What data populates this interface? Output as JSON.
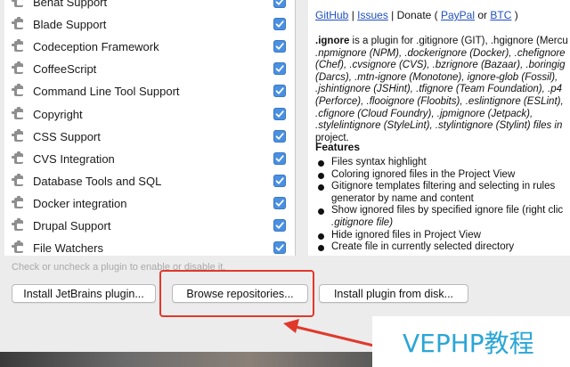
{
  "plugins": [
    {
      "name": "Behat Support",
      "checked": true
    },
    {
      "name": "Blade Support",
      "checked": true
    },
    {
      "name": "Codeception Framework",
      "checked": true
    },
    {
      "name": "CoffeeScript",
      "checked": true
    },
    {
      "name": "Command Line Tool Support",
      "checked": true
    },
    {
      "name": "Copyright",
      "checked": true
    },
    {
      "name": "CSS Support",
      "checked": true
    },
    {
      "name": "CVS Integration",
      "checked": true
    },
    {
      "name": "Database Tools and SQL",
      "checked": true
    },
    {
      "name": "Docker integration",
      "checked": true
    },
    {
      "name": "Drupal Support",
      "checked": true
    },
    {
      "name": "File Watchers",
      "checked": true
    }
  ],
  "detail": {
    "links": {
      "github": "GitHub",
      "sep1": " | ",
      "issues": "Issues",
      "sep2": " | Donate ( ",
      "paypal": "PayPal",
      "or": " or ",
      "btc": "BTC",
      "close": " )"
    },
    "desc_lead": ".ignore",
    "desc_lines": [
      " is a plugin for .gitignore (GIT), .hgignore (Mercu",
      ".npmignore (NPM), .dockerignore (Docker), .chefignore",
      "(Chef), .cvsignore (CVS), .bzrignore (Bazaar), .boringig",
      "(Darcs), .mtn-ignore (Monotone), ignore-glob (Fossil),",
      ".jshintignore (JSHint), .tfignore (Team Foundation), .p4",
      "(Perforce), .flooignore (Floobits), .eslintignore (ESLint),",
      ".cfignore (Cloud Foundry), .jpmignore (Jetpack),",
      ".stylelintignore (StyleLint), .stylintignore (Stylint) files in",
      "project."
    ],
    "features_title": "Features",
    "features": [
      "Files syntax highlight",
      "Coloring ignored files in the Project View",
      "Gitignore templates filtering and selecting in rules",
      "generator by name and content",
      "Show ignored files by specified ignore file (right clic",
      ".gitignore file)",
      "Hide ignored files in Project View",
      "Create file in currently selected directory"
    ]
  },
  "hint": "Check or uncheck a plugin to enable or disable it.",
  "buttons": {
    "install_jetbrains": "Install JetBrains plugin...",
    "browse": "Browse repositories...",
    "install_disk": "Install plugin from disk..."
  },
  "watermark": "VEPHP教程",
  "colors": {
    "checkbox": "#4a90e2",
    "highlight": "#e0392b",
    "link": "#1f4fbf",
    "watermark": "#2aa6d6"
  }
}
